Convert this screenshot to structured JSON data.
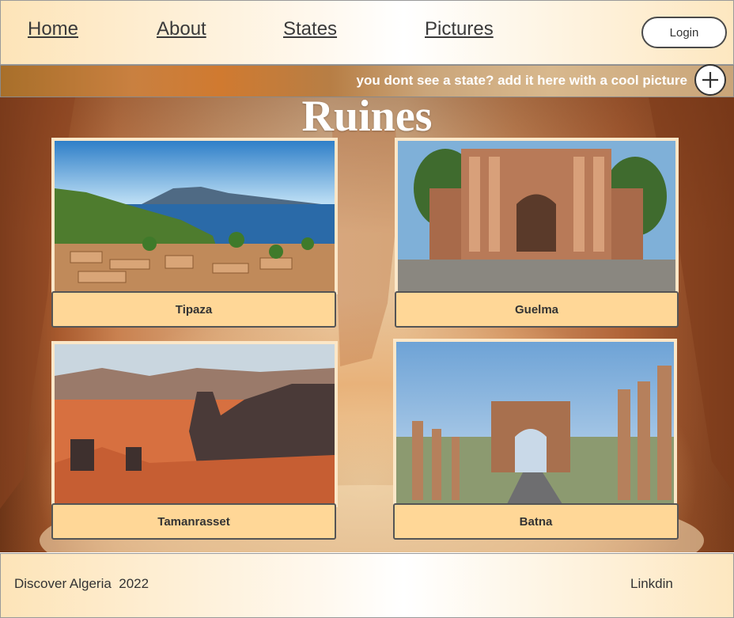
{
  "nav": {
    "links": [
      "Home",
      "About",
      "States",
      "Pictures"
    ],
    "login_label": "Login"
  },
  "banner": {
    "text": "you dont see a state? add it here with a cool picture",
    "add_icon": "plus-icon"
  },
  "hero": {
    "title": "Ruines",
    "cards": [
      {
        "label": "Tipaza"
      },
      {
        "label": "Guelma"
      },
      {
        "label": "Tamanrasset"
      },
      {
        "label": "Batna"
      }
    ]
  },
  "footer": {
    "left": "Discover Algeria  2022",
    "right": "Linkdin"
  }
}
